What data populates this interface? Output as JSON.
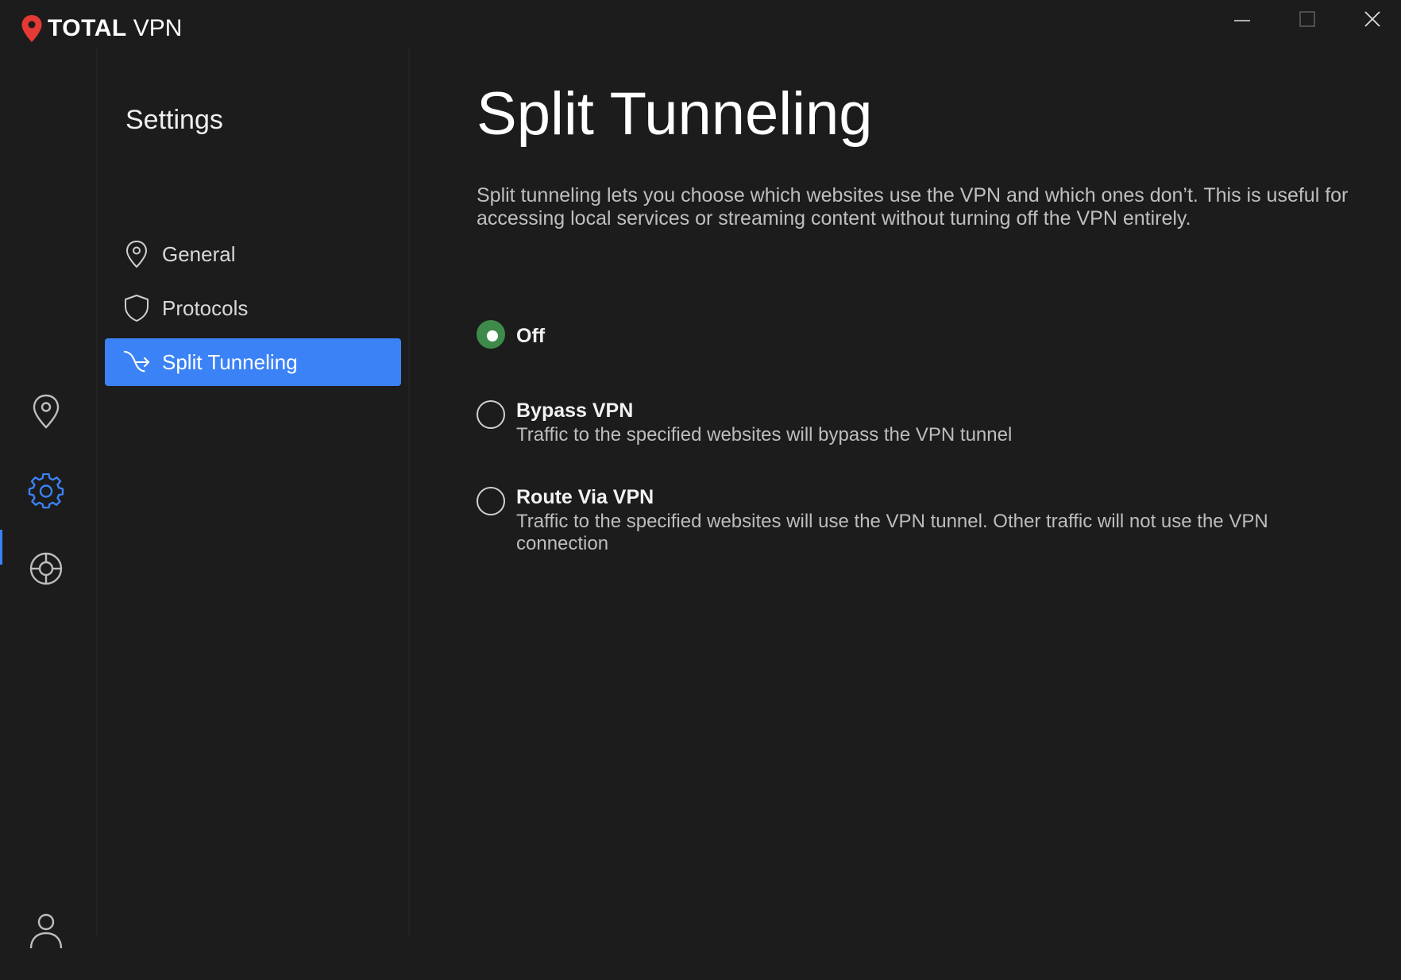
{
  "app": {
    "brand_strong": "TOTAL",
    "brand_light": "VPN",
    "logo_color": "#e53935"
  },
  "window_controls": {
    "minimize_icon": "minimize-icon",
    "maximize_icon": "maximize-icon",
    "close_icon": "close-icon"
  },
  "rail": {
    "items": [
      {
        "icon": "location-pin-icon",
        "active": false
      },
      {
        "icon": "gear-icon",
        "active": true
      },
      {
        "icon": "lifebuoy-icon",
        "active": false
      },
      {
        "icon": "user-icon",
        "active": false
      }
    ],
    "active_color": "#3b82f6"
  },
  "settings": {
    "title": "Settings",
    "items": [
      {
        "label": "General",
        "icon": "location-pin-icon",
        "active": false
      },
      {
        "label": "Protocols",
        "icon": "shield-icon",
        "active": false
      },
      {
        "label": "Split Tunneling",
        "icon": "split-arrow-icon",
        "active": true
      }
    ],
    "active_bg": "#3b82f6"
  },
  "main": {
    "title": "Split Tunneling",
    "description": "Split tunneling lets you choose which websites use the VPN and which ones don’t. This is useful for accessing local services or streaming content without turning off the VPN entirely.",
    "options": [
      {
        "title": "Off",
        "description": "",
        "selected": true
      },
      {
        "title": "Bypass VPN",
        "description": "Traffic to the specified websites will bypass the VPN tunnel",
        "selected": false
      },
      {
        "title": "Route Via VPN",
        "description": "Traffic to the specified websites will use the VPN tunnel. Other traffic will not use the VPN connection",
        "selected": false
      }
    ],
    "selected_color": "#3e8a4a"
  }
}
